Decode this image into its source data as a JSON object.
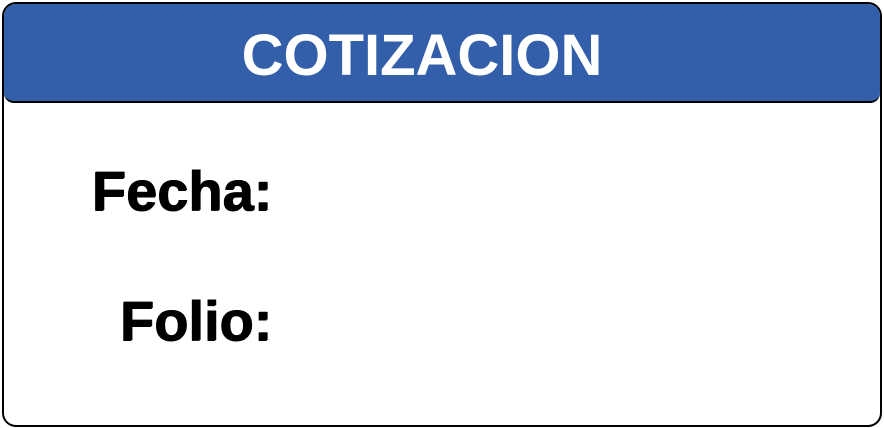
{
  "header": {
    "title": "COTIZACION",
    "background_color": "#335FAA",
    "text_color": "#FFFFFF"
  },
  "fields": {
    "fecha_label": "Fecha:",
    "folio_label": "Folio:"
  },
  "colors": {
    "border": "#000000",
    "card_background": "#FFFFFF"
  }
}
